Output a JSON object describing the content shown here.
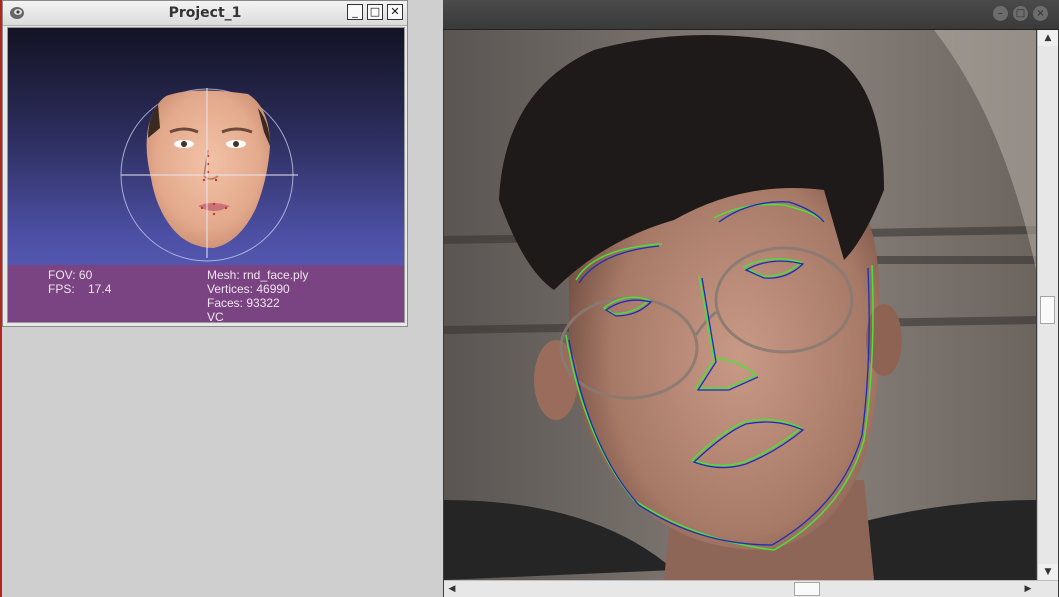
{
  "project_window": {
    "title": "Project_1",
    "buttons": {
      "minimize": "_",
      "maximize": "□",
      "close": "✕"
    },
    "info": {
      "fov": "FOV: 60",
      "fps": "FPS:    17.4",
      "mesh": "Mesh: rnd_face.ply",
      "vertices": "Vertices: 46990",
      "faces": "Faces: 93322",
      "mode": "VC"
    }
  },
  "camera_window": {
    "title_buttons": [
      "minimize",
      "maximize",
      "close"
    ],
    "scroll": {
      "up": "▲",
      "down": "▼",
      "left": "◀",
      "right": "▶"
    }
  },
  "colors": {
    "landmark_green": "#4ee03a",
    "landmark_blue": "#1a2fb8",
    "info_bar": "#7a4483"
  }
}
